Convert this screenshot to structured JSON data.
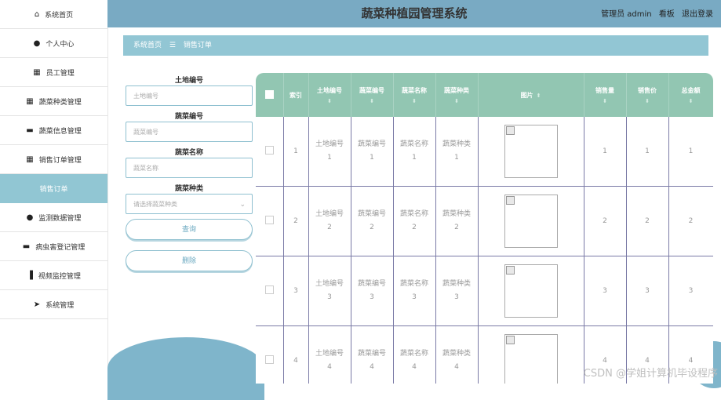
{
  "sidebar": {
    "items": [
      {
        "label": "系统首页",
        "icon": "home-icon",
        "glyph": "⌂"
      },
      {
        "label": "个人中心",
        "icon": "person-icon",
        "glyph": "●"
      },
      {
        "label": "员工管理",
        "icon": "grid-icon",
        "glyph": "▦"
      },
      {
        "label": "蔬菜种类管理",
        "icon": "grid-icon",
        "glyph": "▦"
      },
      {
        "label": "蔬菜信息管理",
        "icon": "briefcase-icon",
        "glyph": "▬"
      },
      {
        "label": "销售订单管理",
        "icon": "grid-icon",
        "glyph": "▦"
      },
      {
        "label": "销售订单",
        "icon": "",
        "glyph": "",
        "sub": true
      },
      {
        "label": "监测数据管理",
        "icon": "person-icon",
        "glyph": "●"
      },
      {
        "label": "病虫害登记管理",
        "icon": "truck-icon",
        "glyph": "▬"
      },
      {
        "label": "视频监控管理",
        "icon": "bar-chart-icon",
        "glyph": "▐"
      },
      {
        "label": "系统管理",
        "icon": "send-icon",
        "glyph": "➤"
      }
    ]
  },
  "header": {
    "title": "蔬菜种植园管理系统",
    "user": "管理员 admin",
    "dashboard": "看板",
    "logout": "退出登录"
  },
  "breadcrumb": {
    "home": "系统首页",
    "sep": "☰",
    "current": "销售订单"
  },
  "search": {
    "land_label": "土地编号",
    "land_placeholder": "土地编号",
    "veg_no_label": "蔬菜编号",
    "veg_no_placeholder": "蔬菜编号",
    "veg_name_label": "蔬菜名称",
    "veg_name_placeholder": "蔬菜名称",
    "veg_type_label": "蔬菜种类",
    "veg_type_placeholder": "请选择蔬菜种类",
    "query_button": "查询",
    "delete_button": "删除"
  },
  "table": {
    "columns": [
      "索引",
      "土地编号",
      "蔬菜编号",
      "蔬菜名称",
      "蔬菜种类",
      "图片",
      "销售量",
      "销售价",
      "总金额"
    ],
    "sort_icon": "⬍",
    "rows": [
      {
        "index": "1",
        "land": "土地编号\n1",
        "veg_no": "蔬菜编号\n1",
        "veg_name": "蔬菜名称\n1",
        "veg_type": "蔬菜种类\n1",
        "qty": "1",
        "price": "1",
        "total": "1"
      },
      {
        "index": "2",
        "land": "土地编号\n2",
        "veg_no": "蔬菜编号\n2",
        "veg_name": "蔬菜名称\n2",
        "veg_type": "蔬菜种类\n2",
        "qty": "2",
        "price": "2",
        "total": "2"
      },
      {
        "index": "3",
        "land": "土地编号\n3",
        "veg_no": "蔬菜编号\n3",
        "veg_name": "蔬菜名称\n3",
        "veg_type": "蔬菜种类\n3",
        "qty": "3",
        "price": "3",
        "total": "3"
      },
      {
        "index": "4",
        "land": "土地编号\n4",
        "veg_no": "蔬菜编号\n4",
        "veg_name": "蔬菜名称\n4",
        "veg_type": "蔬菜种类\n4",
        "qty": "4",
        "price": "4",
        "total": "4"
      }
    ]
  },
  "watermark": "CSDN @学姐计算机毕设程序",
  "colors": {
    "header": "#79aac3",
    "breadcrumb": "#92c6d4",
    "table_header": "#92c6b2",
    "active_sub": "#91c6d3"
  }
}
